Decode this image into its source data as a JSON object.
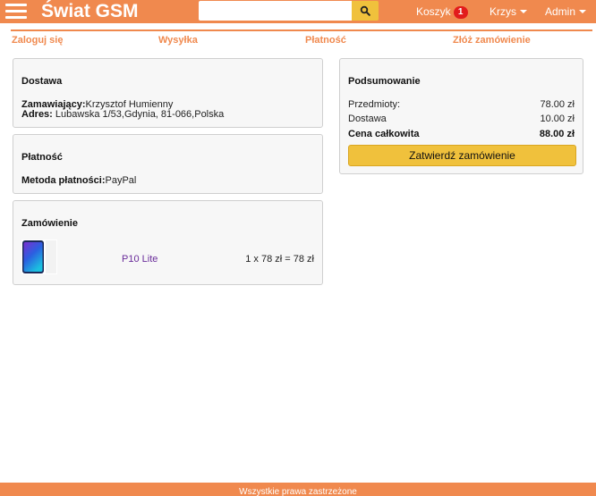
{
  "navbar": {
    "brand": "Świat GSM",
    "search": {
      "value": "",
      "placeholder": ""
    },
    "cart_label": "Koszyk",
    "cart_count": "1",
    "user_label": "Krzys",
    "admin_label": "Admin"
  },
  "steps": [
    "Zaloguj się",
    "Wysyłka",
    "Płatność",
    "Złóż zamówienie"
  ],
  "shipping": {
    "title": "Dostawa",
    "customer_label": "Zamawiający:",
    "customer_value": "Krzysztof Humienny",
    "address_label": "Adres:",
    "address_value": " Lubawska 1/53,Gdynia, 81-066,Polska"
  },
  "payment": {
    "title": "Płatność",
    "method_label": "Metoda płatności:",
    "method_value": "PayPal"
  },
  "order": {
    "title": "Zamówienie",
    "items": [
      {
        "name": "P10 Lite",
        "calc": "1 x 78 zł = 78 zł"
      }
    ]
  },
  "summary": {
    "title": "Podsumowanie",
    "items_label": "Przedmioty:",
    "items_value": "78.00 zł",
    "shipping_label": "Dostawa",
    "shipping_value": "10.00 zł",
    "total_label": "Cena całkowita",
    "total_value": "88.00 zł",
    "confirm_label": "Zatwierdź zamówienie"
  },
  "footer": {
    "text": "Wszystkie prawa zastrzeżone"
  },
  "colors": {
    "accent": "#f0894e",
    "button": "#f0c13c",
    "badge": "#e21c1c",
    "link": "#6a2c9a"
  },
  "icons": [
    "menu-icon",
    "search-icon",
    "chevron-down-icon"
  ]
}
